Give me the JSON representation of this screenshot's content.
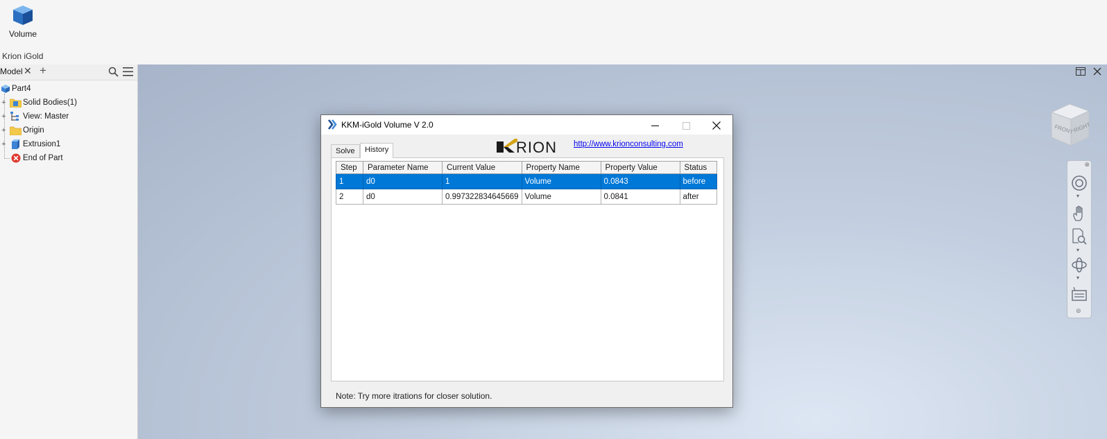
{
  "ribbon": {
    "volume_button_label": "Volume",
    "panel_label": "Krion iGold"
  },
  "browser": {
    "tab_label": "Model",
    "tree": [
      {
        "label": "Part4"
      },
      {
        "label": "Solid Bodies(1)"
      },
      {
        "label": "View: Master"
      },
      {
        "label": "Origin"
      },
      {
        "label": "Extrusion1"
      },
      {
        "label": "End of Part"
      }
    ]
  },
  "viewcube": {
    "front_label": "FRONT",
    "right_label": "RIGHT"
  },
  "dialog": {
    "title": "KKM-iGold Volume V 2.0",
    "tabs": [
      "Solve",
      "History"
    ],
    "active_tab": "History",
    "logo_text": "RION",
    "logo_letter": "K",
    "link": "http://www.krionconsulting.com",
    "columns": [
      "Step",
      "Parameter Name",
      "Current Value",
      "Property Name",
      "Property Value",
      "Status"
    ],
    "rows": [
      [
        "1",
        "d0",
        "1",
        "Volume",
        "0.0843",
        "before"
      ],
      [
        "2",
        "d0",
        "0.997322834645669",
        "Volume",
        "0.0841",
        "after"
      ]
    ],
    "selected_row": 0,
    "note": "Note: Try more itrations for closer solution."
  },
  "colors": {
    "selection": "#0078d7",
    "logo_gold": "#d4a417",
    "link": "#0000ee"
  }
}
